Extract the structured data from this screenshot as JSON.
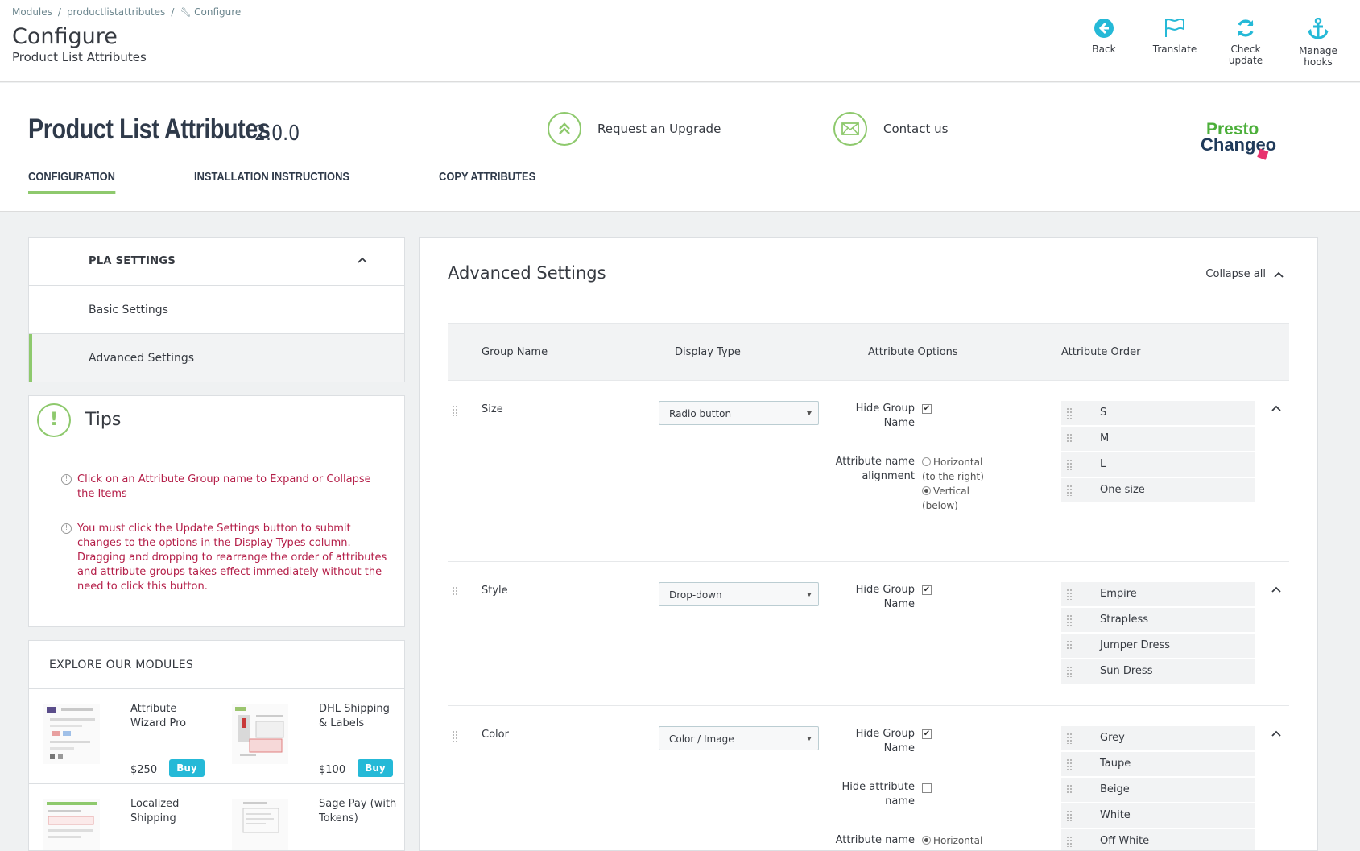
{
  "breadcrumb": {
    "items": [
      "Modules",
      "productlistattributes",
      "Configure"
    ]
  },
  "header": {
    "title": "Configure",
    "subtitle": "Product List Attributes"
  },
  "toolbar": {
    "back": "Back",
    "translate": "Translate",
    "check_update": "Check update",
    "manage_hooks": "Manage hooks"
  },
  "module": {
    "name": "Product List Attributes",
    "version": "2.0.0",
    "upgrade_label": "Request an Upgrade",
    "contact_label": "Contact us",
    "logo_text_1": "Presto",
    "logo_text_2": "Changeo"
  },
  "tabs": [
    {
      "label": "CONFIGURATION",
      "active": true
    },
    {
      "label": "INSTALLATION INSTRUCTIONS",
      "active": false
    },
    {
      "label": "COPY ATTRIBUTES",
      "active": false
    }
  ],
  "pla": {
    "heading": "PLA SETTINGS",
    "items": [
      "Basic Settings",
      "Advanced Settings"
    ]
  },
  "tips": {
    "title": "Tips",
    "items": [
      "Click on an Attribute Group name to Expand or Collapse the Items",
      "You must click the Update Settings button to submit changes to the options in the Display Types column. Dragging and dropping to rearrange the order of attributes and attribute groups takes effect immediately without the need to click this button."
    ]
  },
  "explore": {
    "heading": "EXPLORE OUR MODULES",
    "buy_label": "Buy",
    "modules": [
      {
        "name": "Attribute Wizard Pro",
        "price": "$250"
      },
      {
        "name": "DHL Shipping & Labels",
        "price": "$100"
      },
      {
        "name": "Localized Shipping",
        "price": ""
      },
      {
        "name": "Sage Pay (with Tokens)",
        "price": ""
      }
    ]
  },
  "advanced": {
    "title": "Advanced Settings",
    "collapse_all": "Collapse all",
    "columns": [
      "Group Name",
      "Display Type",
      "Attribute Options",
      "Attribute Order"
    ],
    "labels": {
      "hide_group_name": "Hide Group Name",
      "alignment": "Attribute name alignment",
      "hide_attribute_name": "Hide attribute name",
      "attribute_name": "Attribute name",
      "horizontal": "Horizontal",
      "to_right": "(to the right)",
      "vertical": "Vertical",
      "below": "(below)"
    },
    "groups": [
      {
        "name": "Size",
        "display_type": "Radio button",
        "attributes": [
          "S",
          "M",
          "L",
          "One size"
        ]
      },
      {
        "name": "Style",
        "display_type": "Drop-down",
        "attributes": [
          "Empire",
          "Strapless",
          "Jumper Dress",
          "Sun Dress"
        ]
      },
      {
        "name": "Color",
        "display_type": "Color / Image",
        "attributes": [
          "Grey",
          "Taupe",
          "Beige",
          "White",
          "Off White"
        ]
      }
    ]
  },
  "colors": {
    "accent_green": "#8ec96d",
    "link_blue": "#25b9d7",
    "tip_red": "#b41e48"
  }
}
